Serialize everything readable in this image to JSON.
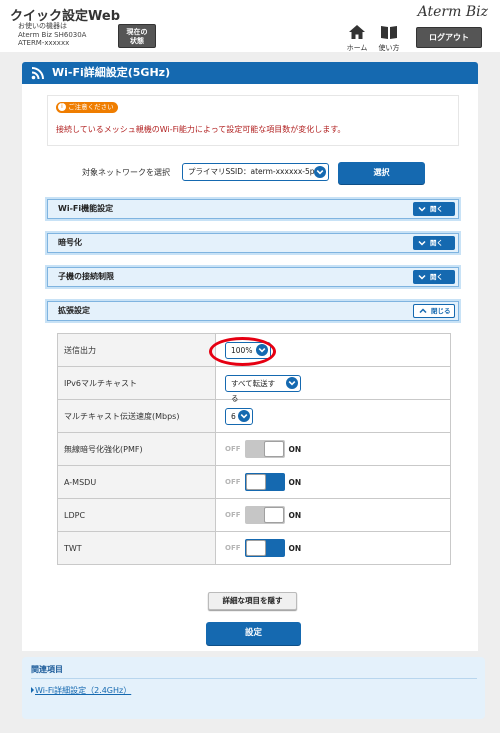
{
  "header": {
    "app_title": "クイック設定Web",
    "device_info_line1": "お使いの機器は",
    "device_info_line2": "Aterm Biz SH6030A",
    "device_info_line3": "ATERM-xxxxxx",
    "status_btn_line1": "現在の",
    "status_btn_line2": "状態",
    "brand": "Aterm Biz",
    "home_label": "ホーム",
    "help_label": "使い方",
    "logout_label": "ログアウト"
  },
  "page": {
    "title": "Wi-Fi詳細設定(5GHz)"
  },
  "notice": {
    "badge": "ご注意ください",
    "text": "接続しているメッシュ親機のWi-Fi能力によって設定可能な項目数が変化します。"
  },
  "network_select": {
    "label": "対象ネットワークを選択",
    "value": "プライマリSSID：aterm-xxxxxx-5p",
    "button_label": "選択"
  },
  "sections": [
    {
      "title": "Wi-Fi機能設定",
      "button": "開く"
    },
    {
      "title": "暗号化",
      "button": "開く"
    },
    {
      "title": "子機の接続制限",
      "button": "開く"
    },
    {
      "title": "拡張設定",
      "button": "閉じる"
    }
  ],
  "toggle_text": {
    "off": "OFF",
    "on": "ON"
  },
  "settings": {
    "tx_power": {
      "label": "送信出力",
      "value": "100%"
    },
    "ipv6_multicast": {
      "label": "IPv6マルチキャスト",
      "value": "すべて転送する"
    },
    "multicast_rate": {
      "label": "マルチキャスト伝送速度(Mbps)",
      "value": "6"
    },
    "pmf": {
      "label": "無線暗号化強化(PMF)",
      "state": "on",
      "enabled": false
    },
    "amsdu": {
      "label": "A-MSDU",
      "state": "on",
      "enabled": true
    },
    "ldpc": {
      "label": "LDPC",
      "state": "on",
      "enabled": false
    },
    "twt": {
      "label": "TWT",
      "state": "on",
      "enabled": true
    }
  },
  "buttons": {
    "hide_details": "詳細な項目を隠す",
    "apply": "設定"
  },
  "related": {
    "title": "関連項目",
    "link": "Wi-Fi詳細設定（2.4GHz）"
  },
  "colors": {
    "primary": "#1569b0",
    "accordion_bg": "#e4f1fb",
    "notice_badge": "#ef7d00",
    "notice_text": "#b22222",
    "highlight_circle": "#e60012"
  }
}
